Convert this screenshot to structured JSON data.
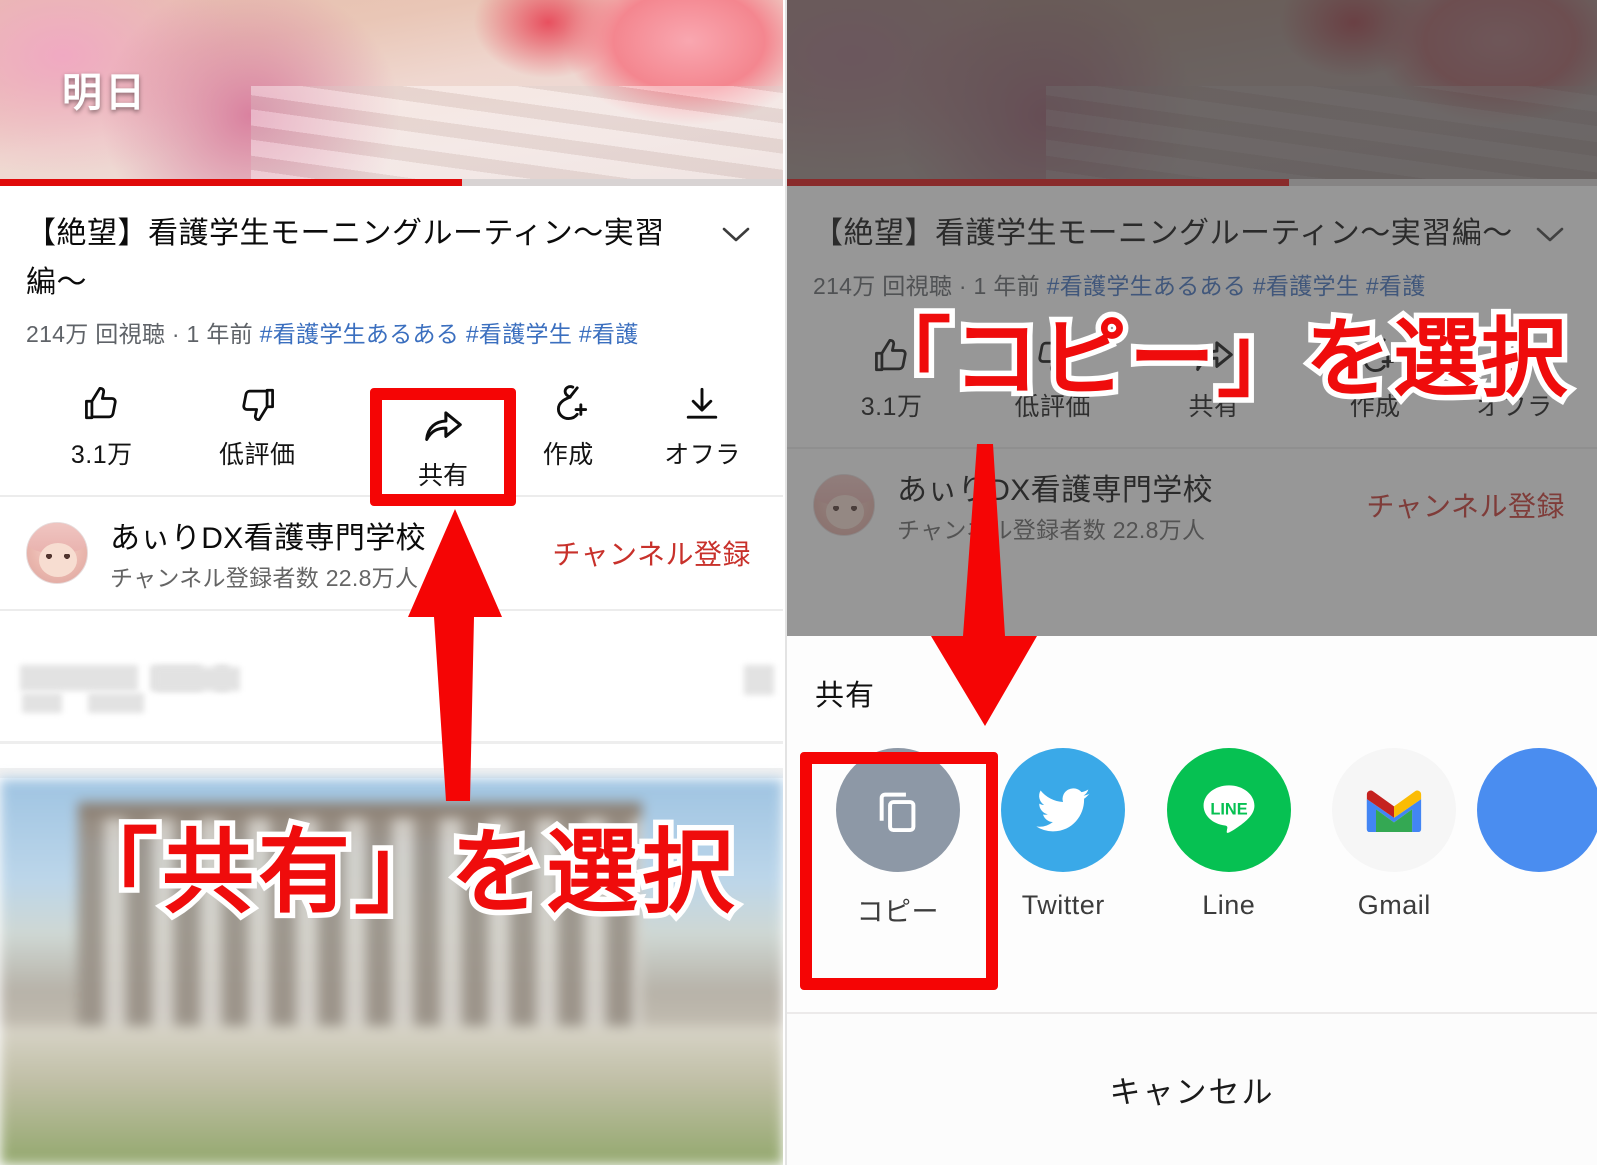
{
  "meta_info": {
    "app": "YouTube",
    "screenshot_kind": "tutorial-two-panel",
    "accent_red": "#ef0c0c",
    "link_blue": "#3b6fbf",
    "sub_red": "#c8312b"
  },
  "video": {
    "caption": "明日",
    "progress_percent_left": 59,
    "progress_percent_right": 62
  },
  "info": {
    "title": "【絶望】看護学生モーニングルーティン〜実習編〜",
    "expand_icon": "chevron-down-icon",
    "views": "214万 回視聴",
    "separator": "·",
    "age": "1 年前",
    "hashtags": [
      "#看護学生あるある",
      "#看護学生",
      "#看護"
    ]
  },
  "actions": [
    {
      "icon": "thumbs-up-icon",
      "label": "3.1万",
      "name": "like"
    },
    {
      "icon": "thumbs-down-icon",
      "label": "低評価",
      "name": "dislike"
    },
    {
      "icon": "share-icon",
      "label": "共有",
      "name": "share"
    },
    {
      "icon": "create-clip-icon",
      "label": "作成",
      "name": "create"
    },
    {
      "icon": "download-icon",
      "label": "オフラ",
      "name": "offline"
    }
  ],
  "channel": {
    "name": "あぃりDX看護専門学校",
    "subscribers": "チャンネル登録者数 22.8万人",
    "subscribe_label": "チャンネル登録",
    "avatar_name": "channel-avatar"
  },
  "share_sheet": {
    "title": "共有",
    "apps": [
      {
        "label": "コピー",
        "icon": "copy-icon",
        "color": "#8d98a6",
        "name": "copy"
      },
      {
        "label": "Twitter",
        "icon": "twitter-icon",
        "color": "#3aa9e8",
        "name": "twitter"
      },
      {
        "label": "Line",
        "icon": "line-icon",
        "color": "#06c152",
        "name": "line"
      },
      {
        "label": "Gmail",
        "icon": "gmail-icon",
        "color": "#f6f6f6",
        "name": "gmail"
      },
      {
        "label": "",
        "icon": "more-app-icon",
        "color": "#4a8df0",
        "name": "more"
      }
    ],
    "cancel_label": "キャンセル"
  },
  "annotations": {
    "left_text": "「共有」を選択",
    "right_text": "「コピー」を選択",
    "left_arrow": "arrow-up-to-share-button",
    "right_arrow": "arrow-down-to-copy-button"
  }
}
